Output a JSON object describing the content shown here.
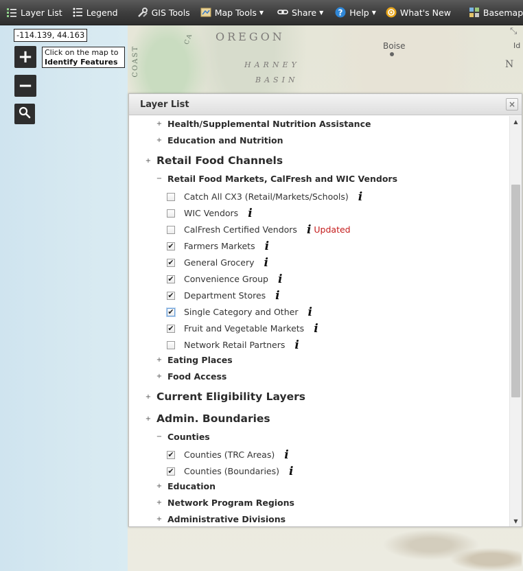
{
  "toolbar": {
    "items": [
      {
        "label": "Layer List",
        "icon": "layer-list-icon",
        "dropdown": false
      },
      {
        "label": "Legend",
        "icon": "legend-icon",
        "dropdown": false
      },
      {
        "label": "GIS Tools",
        "icon": "tools-icon",
        "dropdown": false
      },
      {
        "label": "Map Tools",
        "icon": "map-tools-icon",
        "dropdown": true
      },
      {
        "label": "Share",
        "icon": "link-icon",
        "dropdown": true
      },
      {
        "label": "Help",
        "icon": "help-icon",
        "dropdown": true
      },
      {
        "label": "What's New",
        "icon": "gear-icon",
        "dropdown": false
      },
      {
        "label": "Basemap",
        "icon": "basemap-icon",
        "dropdown": true
      }
    ]
  },
  "map": {
    "coordinates": "-114.139, 44.163",
    "tooltip_line1": "Click on the map to",
    "tooltip_line2": "Identify Features",
    "zoom_in": "+",
    "zoom_out": "−",
    "labels": {
      "oregon": "OREGON",
      "harney": "HARNEY",
      "basin": "BASIN",
      "boise": "Boise",
      "id": "Id",
      "n": "N",
      "coast": "COAST",
      "cascade": "CA"
    }
  },
  "panel": {
    "title": "Layer List",
    "close": "×",
    "rows": [
      {
        "kind": "g2",
        "toggle": "+",
        "label": "Health/Supplemental Nutrition Assistance"
      },
      {
        "kind": "g2",
        "toggle": "+",
        "label": "Education and Nutrition"
      },
      {
        "kind": "g1",
        "toggle": "+",
        "label": "Retail Food Channels"
      },
      {
        "kind": "g2",
        "toggle": "−",
        "label": "Retail Food Markets, CalFresh and WIC Vendors"
      },
      {
        "kind": "layer",
        "checked": false,
        "label": "Catch All CX3 (Retail/Markets/Schools)",
        "info": true
      },
      {
        "kind": "layer",
        "checked": false,
        "label": "WIC Vendors",
        "info": true
      },
      {
        "kind": "layer",
        "checked": false,
        "label": "CalFresh Certified Vendors",
        "info": true,
        "badge": "Updated"
      },
      {
        "kind": "layer",
        "checked": true,
        "label": "Farmers Markets",
        "info": true
      },
      {
        "kind": "layer",
        "checked": true,
        "label": "General Grocery",
        "info": true
      },
      {
        "kind": "layer",
        "checked": true,
        "label": "Convenience Group",
        "info": true
      },
      {
        "kind": "layer",
        "checked": true,
        "label": "Department Stores",
        "info": true
      },
      {
        "kind": "layer",
        "checked": true,
        "focus": true,
        "label": "Single Category and Other",
        "info": true
      },
      {
        "kind": "layer",
        "checked": true,
        "label": "Fruit and Vegetable Markets",
        "info": true
      },
      {
        "kind": "layer",
        "checked": false,
        "label": "Network Retail Partners",
        "info": true
      },
      {
        "kind": "g2",
        "toggle": "+",
        "label": "Eating Places"
      },
      {
        "kind": "g2",
        "toggle": "+",
        "label": "Food Access"
      },
      {
        "kind": "g1",
        "toggle": "+",
        "label": "Current Eligibility Layers"
      },
      {
        "kind": "g1",
        "toggle": "+",
        "label": "Admin. Boundaries"
      },
      {
        "kind": "g2",
        "toggle": "−",
        "label": "Counties"
      },
      {
        "kind": "layer",
        "checked": true,
        "label": "Counties (TRC Areas)",
        "info": true
      },
      {
        "kind": "layer",
        "checked": true,
        "label": "Counties (Boundaries)",
        "info": true
      },
      {
        "kind": "g2",
        "toggle": "+",
        "label": "Education"
      },
      {
        "kind": "g2",
        "toggle": "+",
        "label": "Network Program Regions"
      },
      {
        "kind": "g2",
        "toggle": "+",
        "label": "Administrative Divisions"
      }
    ]
  }
}
